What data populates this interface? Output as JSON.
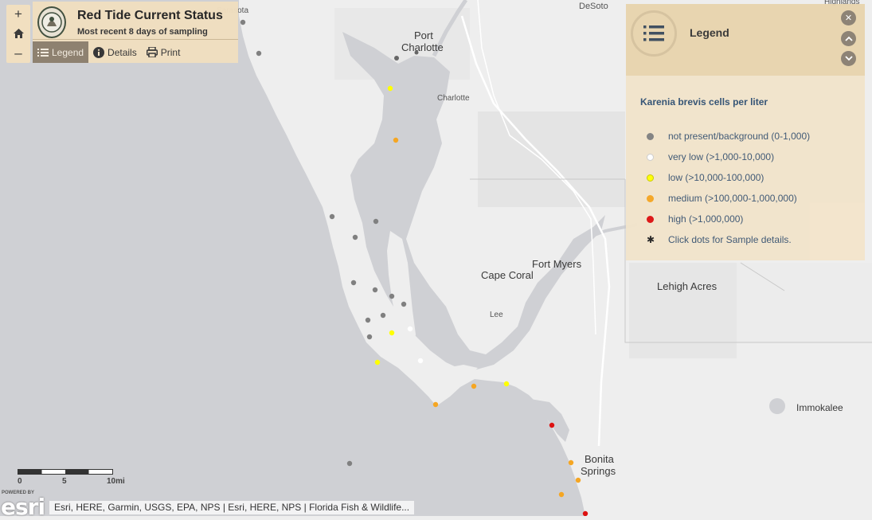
{
  "title_panel": {
    "title": "Red Tide Current Status",
    "subtitle": "Most recent 8 days of sampling",
    "tabs": [
      {
        "label": "Legend",
        "icon": "list-icon",
        "active": true
      },
      {
        "label": "Details",
        "icon": "info-icon",
        "active": false
      },
      {
        "label": "Print",
        "icon": "printer-icon",
        "active": false
      }
    ]
  },
  "zoom": {
    "in": "+",
    "home_icon": "home-icon",
    "out": "–"
  },
  "legend": {
    "title": "Legend",
    "subtitle": "Karenia brevis cells per liter",
    "items": [
      {
        "label": "not present/background (0-1,000)",
        "color": "#808080"
      },
      {
        "label": "very low (>1,000-10,000)",
        "color": "#ffffff"
      },
      {
        "label": "low (>10,000-100,000)",
        "color": "#ffff00"
      },
      {
        "label": "medium (>100,000-1,000,000)",
        "color": "#f5a623"
      },
      {
        "label": "high (>1,000,000)",
        "color": "#dd1111"
      },
      {
        "label": "Click dots for Sample details.",
        "color": "#222222",
        "marker": "star"
      }
    ]
  },
  "map_labels": {
    "sarasota": "Sarasota",
    "desoto": "DeSoto",
    "highlands": "Highlands",
    "port_charlotte_1": "Port",
    "port_charlotte_2": "Charlotte",
    "charlotte": "Charlotte",
    "fort_myers": "Fort Myers",
    "cape_coral": "Cape Coral",
    "lee": "Lee",
    "lehigh_acres": "Lehigh Acres",
    "immokalee": "Immokalee",
    "bonita_1": "Bonita",
    "bonita_2": "Springs"
  },
  "scalebar": {
    "labels": [
      "0",
      "5",
      "10mi"
    ]
  },
  "attribution": {
    "powered_by": "POWERED BY",
    "logo": "esri",
    "text": "Esri, HERE, Garmin, USGS, EPA, NPS | Esri, HERE, NPS | Florida Fish & Wildlife..."
  }
}
